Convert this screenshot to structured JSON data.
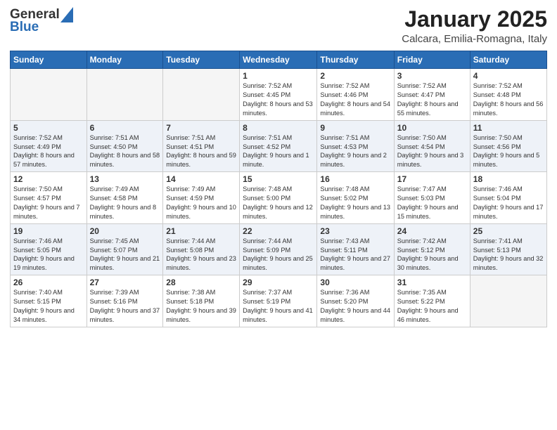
{
  "header": {
    "logo_general": "General",
    "logo_blue": "Blue",
    "month": "January 2025",
    "location": "Calcara, Emilia-Romagna, Italy"
  },
  "days_of_week": [
    "Sunday",
    "Monday",
    "Tuesday",
    "Wednesday",
    "Thursday",
    "Friday",
    "Saturday"
  ],
  "weeks": [
    [
      {
        "day": "",
        "info": ""
      },
      {
        "day": "",
        "info": ""
      },
      {
        "day": "",
        "info": ""
      },
      {
        "day": "1",
        "info": "Sunrise: 7:52 AM\nSunset: 4:45 PM\nDaylight: 8 hours and 53 minutes."
      },
      {
        "day": "2",
        "info": "Sunrise: 7:52 AM\nSunset: 4:46 PM\nDaylight: 8 hours and 54 minutes."
      },
      {
        "day": "3",
        "info": "Sunrise: 7:52 AM\nSunset: 4:47 PM\nDaylight: 8 hours and 55 minutes."
      },
      {
        "day": "4",
        "info": "Sunrise: 7:52 AM\nSunset: 4:48 PM\nDaylight: 8 hours and 56 minutes."
      }
    ],
    [
      {
        "day": "5",
        "info": "Sunrise: 7:52 AM\nSunset: 4:49 PM\nDaylight: 8 hours and 57 minutes."
      },
      {
        "day": "6",
        "info": "Sunrise: 7:51 AM\nSunset: 4:50 PM\nDaylight: 8 hours and 58 minutes."
      },
      {
        "day": "7",
        "info": "Sunrise: 7:51 AM\nSunset: 4:51 PM\nDaylight: 8 hours and 59 minutes."
      },
      {
        "day": "8",
        "info": "Sunrise: 7:51 AM\nSunset: 4:52 PM\nDaylight: 9 hours and 1 minute."
      },
      {
        "day": "9",
        "info": "Sunrise: 7:51 AM\nSunset: 4:53 PM\nDaylight: 9 hours and 2 minutes."
      },
      {
        "day": "10",
        "info": "Sunrise: 7:50 AM\nSunset: 4:54 PM\nDaylight: 9 hours and 3 minutes."
      },
      {
        "day": "11",
        "info": "Sunrise: 7:50 AM\nSunset: 4:56 PM\nDaylight: 9 hours and 5 minutes."
      }
    ],
    [
      {
        "day": "12",
        "info": "Sunrise: 7:50 AM\nSunset: 4:57 PM\nDaylight: 9 hours and 7 minutes."
      },
      {
        "day": "13",
        "info": "Sunrise: 7:49 AM\nSunset: 4:58 PM\nDaylight: 9 hours and 8 minutes."
      },
      {
        "day": "14",
        "info": "Sunrise: 7:49 AM\nSunset: 4:59 PM\nDaylight: 9 hours and 10 minutes."
      },
      {
        "day": "15",
        "info": "Sunrise: 7:48 AM\nSunset: 5:00 PM\nDaylight: 9 hours and 12 minutes."
      },
      {
        "day": "16",
        "info": "Sunrise: 7:48 AM\nSunset: 5:02 PM\nDaylight: 9 hours and 13 minutes."
      },
      {
        "day": "17",
        "info": "Sunrise: 7:47 AM\nSunset: 5:03 PM\nDaylight: 9 hours and 15 minutes."
      },
      {
        "day": "18",
        "info": "Sunrise: 7:46 AM\nSunset: 5:04 PM\nDaylight: 9 hours and 17 minutes."
      }
    ],
    [
      {
        "day": "19",
        "info": "Sunrise: 7:46 AM\nSunset: 5:05 PM\nDaylight: 9 hours and 19 minutes."
      },
      {
        "day": "20",
        "info": "Sunrise: 7:45 AM\nSunset: 5:07 PM\nDaylight: 9 hours and 21 minutes."
      },
      {
        "day": "21",
        "info": "Sunrise: 7:44 AM\nSunset: 5:08 PM\nDaylight: 9 hours and 23 minutes."
      },
      {
        "day": "22",
        "info": "Sunrise: 7:44 AM\nSunset: 5:09 PM\nDaylight: 9 hours and 25 minutes."
      },
      {
        "day": "23",
        "info": "Sunrise: 7:43 AM\nSunset: 5:11 PM\nDaylight: 9 hours and 27 minutes."
      },
      {
        "day": "24",
        "info": "Sunrise: 7:42 AM\nSunset: 5:12 PM\nDaylight: 9 hours and 30 minutes."
      },
      {
        "day": "25",
        "info": "Sunrise: 7:41 AM\nSunset: 5:13 PM\nDaylight: 9 hours and 32 minutes."
      }
    ],
    [
      {
        "day": "26",
        "info": "Sunrise: 7:40 AM\nSunset: 5:15 PM\nDaylight: 9 hours and 34 minutes."
      },
      {
        "day": "27",
        "info": "Sunrise: 7:39 AM\nSunset: 5:16 PM\nDaylight: 9 hours and 37 minutes."
      },
      {
        "day": "28",
        "info": "Sunrise: 7:38 AM\nSunset: 5:18 PM\nDaylight: 9 hours and 39 minutes."
      },
      {
        "day": "29",
        "info": "Sunrise: 7:37 AM\nSunset: 5:19 PM\nDaylight: 9 hours and 41 minutes."
      },
      {
        "day": "30",
        "info": "Sunrise: 7:36 AM\nSunset: 5:20 PM\nDaylight: 9 hours and 44 minutes."
      },
      {
        "day": "31",
        "info": "Sunrise: 7:35 AM\nSunset: 5:22 PM\nDaylight: 9 hours and 46 minutes."
      },
      {
        "day": "",
        "info": ""
      }
    ]
  ]
}
